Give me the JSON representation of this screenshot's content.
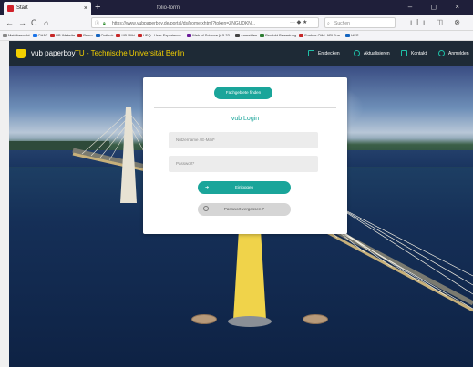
{
  "browser": {
    "tabs": [
      {
        "label": "Start",
        "active": true
      },
      {
        "label": "folio-form",
        "active": false
      }
    ],
    "new_tab": "+",
    "window_controls": "– ◻ ×",
    "nav": {
      "back": "←",
      "forward": "→",
      "reload": "C",
      "home": "⌂"
    },
    "url": "https://www.vubpaperboy.de/portal/ds/home.xhtml?token=ZNGUDKN...",
    "url_icons": "··· ◆ ★",
    "search_placeholder": "Suchen",
    "toolbar_icons": "ılı ◫ ⊗ ≡",
    "bookmarks": [
      {
        "label": "Meistbesucht",
        "color": "#888888"
      },
      {
        "label": "CHAT",
        "color": "#1a73e8"
      },
      {
        "label": "UB Website",
        "color": "#c62828"
      },
      {
        "label": "Primo",
        "color": "#c62828"
      },
      {
        "label": "Outlook",
        "color": "#1565c0"
      },
      {
        "label": "UB-Wiki",
        "color": "#c62828"
      },
      {
        "label": "UEQ - User Experience...",
        "color": "#c62828"
      },
      {
        "label": "Web of Science [v.5.33...",
        "color": "#6a1b9a"
      },
      {
        "label": "Anmelden",
        "color": "#444444"
      },
      {
        "label": "Produkt Bewertung",
        "color": "#2e7d32"
      },
      {
        "label": "Funbox OWL API Fun...",
        "color": "#c62828"
      },
      {
        "label": "HSS",
        "color": "#1565c0"
      }
    ]
  },
  "site": {
    "brand": "vub paperboy",
    "brand_sub": "TU - Technische Universität Berlin",
    "nav": [
      {
        "label": "Entdecken"
      },
      {
        "label": "Aktualisieren"
      },
      {
        "label": "Kontakt"
      },
      {
        "label": "Anmelden"
      }
    ],
    "login": {
      "facebook_button": "Fachgebiete finden",
      "title": "vub Login",
      "username_placeholder": "Nutzername / E-Mail*",
      "password_placeholder": "Passwort*",
      "login_button": "Einloggen",
      "forgot_button": "Passwort vergessen ?"
    }
  },
  "colors": {
    "accent": "#1aa59a",
    "header_bg": "#1e2a36",
    "brand_yellow": "#f4d000"
  }
}
